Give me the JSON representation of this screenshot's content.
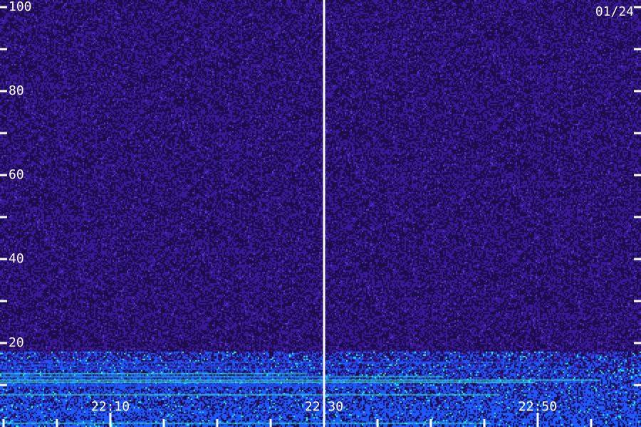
{
  "chart_data": {
    "type": "heatmap",
    "date_label": "01/24",
    "y_tick_labels": [
      "100",
      "80",
      "60",
      "40",
      "20"
    ],
    "y_tick_values": [
      100,
      80,
      60,
      40,
      20
    ],
    "y_minor_tick_values": [
      90,
      70,
      50,
      30,
      10
    ],
    "ylim": [
      0,
      110
    ],
    "x_tick_labels": [
      "22:10",
      "22:30",
      "22:50"
    ],
    "x_tick_values_min": [
      10,
      30,
      50
    ],
    "xlim_min": [
      0,
      60
    ],
    "x_minor_tick_values_min": [
      0,
      5,
      15,
      20,
      25,
      35,
      40,
      45,
      55
    ],
    "divider_at_min": 30,
    "low_band_top": 18,
    "colors": {
      "background": "#1c0c4a",
      "noise": "#3a1a9a",
      "band": "#1e5aff",
      "band_hot": "#30ffd0",
      "axis": "#ffffff"
    }
  }
}
